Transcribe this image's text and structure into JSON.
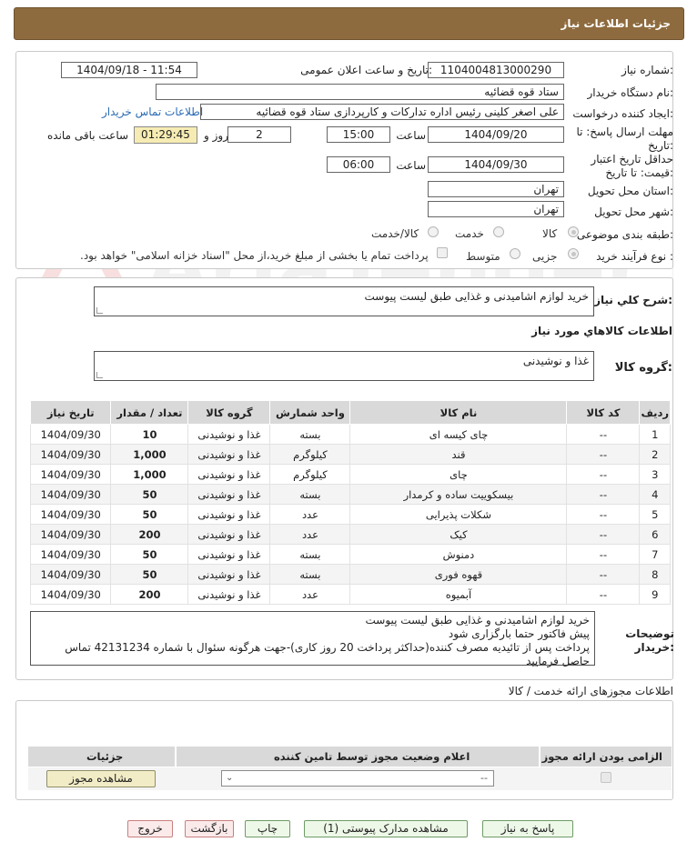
{
  "header": {
    "title": "جزئیات اطلاعات نیاز"
  },
  "form": {
    "need_number_label": "شماره نیاز:",
    "need_number": "1104004813000290",
    "announce_label": "تاریخ و ساعت اعلان عمومی:",
    "announce_value": "1404/09/18 - 11:54",
    "buyer_label": "نام دستگاه خریدار:",
    "buyer_value": "ستاد قوه قضائیه",
    "requester_label": "ایجاد کننده درخواست:",
    "requester_value": "علی اصغر کلینی رئیس اداره تدارکات و کارپردازی ستاد قوه قضائیه",
    "contact_link": "اطلاعات تماس خریدار",
    "reply_deadline_label_1": "مهلت ارسال پاسخ: تا",
    "reply_deadline_label_2": "تاریخ:",
    "reply_date": "1404/09/20",
    "time_label": "ساعت",
    "reply_time": "15:00",
    "days_value": "2",
    "days_label": "روز و",
    "remaining_time": "01:29:45",
    "remaining_label": "ساعت باقی مانده",
    "min_validity_label_1": "حداقل تاریخ اعتبار",
    "min_validity_label_2": "قیمت: تا تاریخ:",
    "validity_date": "1404/09/30",
    "validity_time": "06:00",
    "province_label": "استان محل تحویل:",
    "province_value": "تهران",
    "city_label": "شهر محل تحویل:",
    "city_value": "تهران",
    "category_label": "طبقه بندی موضوعی:",
    "category_options": [
      "کالا",
      "خدمت",
      "کالا/خدمت"
    ],
    "process_label": "نوع فرآیند خرید :",
    "process_options": [
      "جزیی",
      "متوسط"
    ],
    "payment_note": "پرداخت تمام یا بخشی از مبلغ خرید،از محل \"اسناد خزانه اسلامی\" خواهد بود."
  },
  "summary": {
    "label": "شرح کلي نياز:",
    "value": "خرید لوازم اشامیدنی و غذایی طبق لیست پیوست",
    "goods_info_title": "اطلاعات کالاهاي مورد نياز",
    "group_label": "گروه کالا:",
    "group_value": "غذا و نوشیدنی"
  },
  "table": {
    "headers": [
      "ردیف",
      "کد کالا",
      "نام کالا",
      "واحد شمارش",
      "گروه کالا",
      "تعداد / مقدار",
      "تاریخ نیاز"
    ],
    "rows": [
      [
        "1",
        "--",
        "چای کیسه ای",
        "بسته",
        "غذا و نوشیدنی",
        "10",
        "1404/09/30"
      ],
      [
        "2",
        "--",
        "قند",
        "کیلوگرم",
        "غذا و نوشیدنی",
        "1,000",
        "1404/09/30"
      ],
      [
        "3",
        "--",
        "چای",
        "کیلوگرم",
        "غذا و نوشیدنی",
        "1,000",
        "1404/09/30"
      ],
      [
        "4",
        "--",
        "بیسکوییت ساده و کرمدار",
        "بسته",
        "غذا و نوشیدنی",
        "50",
        "1404/09/30"
      ],
      [
        "5",
        "--",
        "شکلات پذیرایی",
        "عدد",
        "غذا و نوشیدنی",
        "50",
        "1404/09/30"
      ],
      [
        "6",
        "--",
        "کیک",
        "عدد",
        "غذا و نوشیدنی",
        "200",
        "1404/09/30"
      ],
      [
        "7",
        "--",
        "دمنوش",
        "بسته",
        "غذا و نوشیدنی",
        "50",
        "1404/09/30"
      ],
      [
        "8",
        "--",
        "قهوه فوری",
        "بسته",
        "غذا و نوشیدنی",
        "50",
        "1404/09/30"
      ],
      [
        "9",
        "--",
        "آبمیوه",
        "عدد",
        "غذا و نوشیدنی",
        "200",
        "1404/09/30"
      ]
    ]
  },
  "buyer_notes": {
    "label_1": "توضیحات",
    "label_2": "خریدار:",
    "line1": "خرید لوازم اشامیدنی و غذایی طبق لیست پیوست",
    "line2": "پیش فاکتور حتما بارگزاری شود",
    "line3": "پرداخت پس از تائیدیه مصرف کننده(حداکثر پرداخت 20 روز کاری)-جهت هرگونه سئوال با شماره 42131234 تماس حاصل فرمایید"
  },
  "permits": {
    "title": "اطلاعات مجوزهای ارائه خدمت / کالا",
    "headers": [
      "الزامی بودن ارائه مجوز",
      "اعلام وضعیت مجوز توسط تامین کننده",
      "جزئیات"
    ],
    "select_value": "--",
    "view_button": "مشاهده مجوز"
  },
  "buttons": {
    "reply": "پاسخ به نیاز",
    "attachments": "مشاهده مدارک پیوستی (1)",
    "print": "چاپ",
    "back": "بازگشت",
    "exit": "خروج"
  },
  "watermark_text": "AriaTender.net"
}
